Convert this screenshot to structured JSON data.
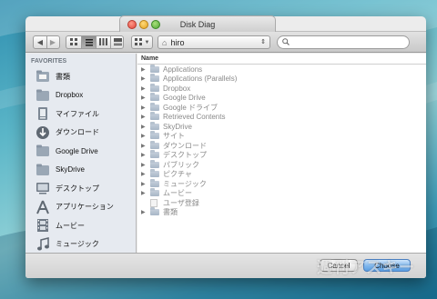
{
  "window": {
    "title": "Disk Diag"
  },
  "toolbar": {
    "back_icon": "chevron-left-icon",
    "forward_icon": "chevron-right-icon",
    "view_icons": [
      "icon-view-icon",
      "list-view-icon",
      "column-view-icon",
      "coverflow-view-icon"
    ],
    "arrange_icon": "arrange-grid-icon",
    "location": {
      "value": "hiro",
      "icon": "home-icon"
    },
    "search": {
      "placeholder": ""
    }
  },
  "sidebar": {
    "header": "FAVORITES",
    "items": [
      {
        "label": "書類",
        "icon": "documents-icon"
      },
      {
        "label": "Dropbox",
        "icon": "folder-icon"
      },
      {
        "label": "マイファイル",
        "icon": "all-my-files-icon"
      },
      {
        "label": "ダウンロード",
        "icon": "downloads-icon"
      },
      {
        "label": "Google Drive",
        "icon": "folder-icon"
      },
      {
        "label": "SkyDrive",
        "icon": "folder-icon"
      },
      {
        "label": "デスクトップ",
        "icon": "desktop-icon"
      },
      {
        "label": "アプリケーション",
        "icon": "applications-icon"
      },
      {
        "label": "ムービー",
        "icon": "movies-icon"
      },
      {
        "label": "ミュージック",
        "icon": "music-icon"
      }
    ]
  },
  "filelist": {
    "column_header": "Name",
    "rows": [
      {
        "name": "Applications",
        "type": "folder",
        "expandable": true
      },
      {
        "name": "Applications (Parallels)",
        "type": "folder",
        "expandable": true
      },
      {
        "name": "Dropbox",
        "type": "folder",
        "expandable": true
      },
      {
        "name": "Google Drive",
        "type": "folder",
        "expandable": true
      },
      {
        "name": "Google ドライブ",
        "type": "folder",
        "expandable": true
      },
      {
        "name": "Retrieved Contents",
        "type": "folder",
        "expandable": true
      },
      {
        "name": "SkyDrive",
        "type": "folder",
        "expandable": true
      },
      {
        "name": "サイト",
        "type": "folder",
        "expandable": true
      },
      {
        "name": "ダウンロード",
        "type": "folder",
        "expandable": true
      },
      {
        "name": "デスクトップ",
        "type": "folder",
        "expandable": true
      },
      {
        "name": "パブリック",
        "type": "folder",
        "expandable": true
      },
      {
        "name": "ピクチャ",
        "type": "folder",
        "expandable": true
      },
      {
        "name": "ミュージック",
        "type": "folder",
        "expandable": true
      },
      {
        "name": "ムービー",
        "type": "folder",
        "expandable": true
      },
      {
        "name": "ユーザ登録",
        "type": "document",
        "expandable": false
      },
      {
        "name": "書類",
        "type": "folder",
        "expandable": true
      }
    ]
  },
  "buttons": {
    "cancel": "Cancel",
    "choose": "Choose"
  },
  "watermark": "週刊アスキー",
  "colors": {
    "accent": "#5c9fe3",
    "sidebar_bg": "#e6eaf0"
  }
}
